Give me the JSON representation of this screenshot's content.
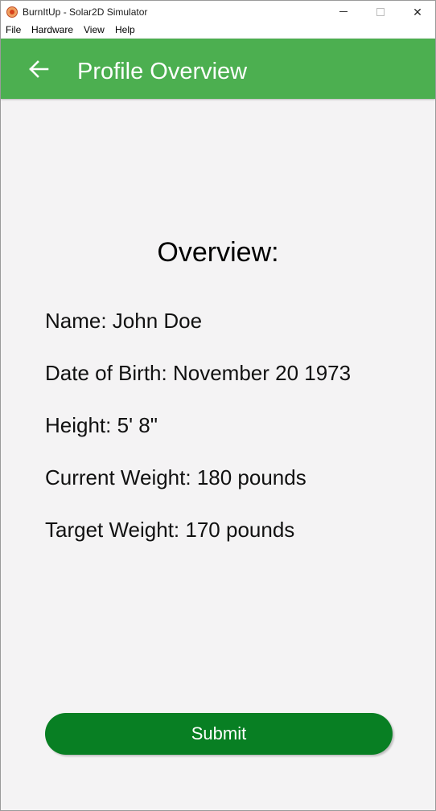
{
  "window": {
    "title": "BurnItUp - Solar2D Simulator",
    "icon": "solar2d-app-icon",
    "controls": {
      "minimize": "minimize-icon",
      "maximize": "maximize-icon",
      "close": "close-icon"
    },
    "close_glyph": "✕"
  },
  "menu": {
    "items": [
      "File",
      "Hardware",
      "View",
      "Help"
    ]
  },
  "header": {
    "back_icon": "back-arrow-icon",
    "title": "Profile Overview",
    "color": "#4caf50"
  },
  "overview": {
    "heading": "Overview:",
    "fields": [
      "Name: John Doe",
      "Date of Birth: November 20 1973",
      "Height: 5' 8\"",
      "Current Weight: 180 pounds",
      "Target Weight: 170 pounds"
    ]
  },
  "submit": {
    "label": "Submit",
    "color": "#087f23"
  }
}
